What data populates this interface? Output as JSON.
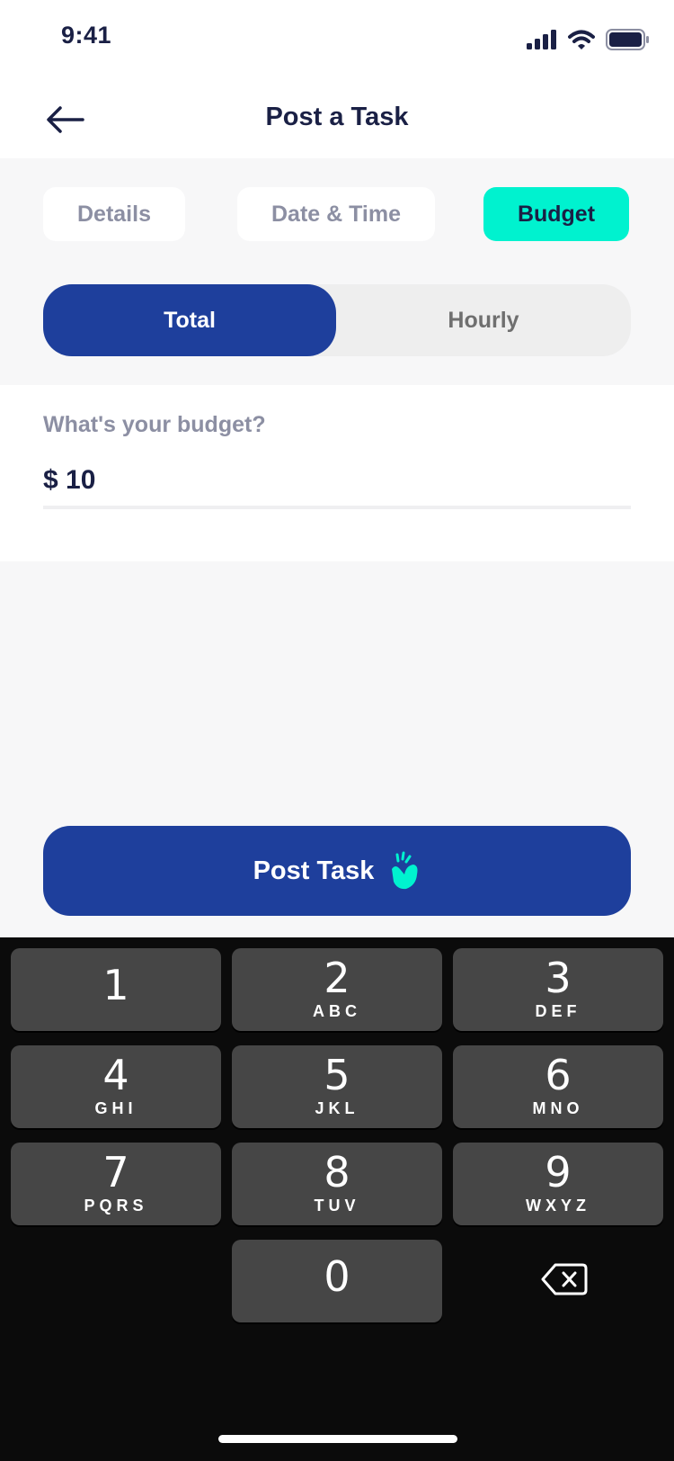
{
  "status_bar": {
    "time": "9:41"
  },
  "nav": {
    "title": "Post a Task",
    "back_icon": "arrow-left-icon"
  },
  "steps": [
    {
      "label": "Details",
      "active": false
    },
    {
      "label": "Date & Time",
      "active": false
    },
    {
      "label": "Budget",
      "active": true
    }
  ],
  "budget_type": {
    "options": [
      "Total",
      "Hourly"
    ],
    "selected": "Total"
  },
  "budget": {
    "label": "What's your budget?",
    "value": "$ 10"
  },
  "post_button": {
    "label": "Post Task",
    "icon": "snap-hand-icon"
  },
  "keypad": {
    "keys": [
      {
        "digit": "1",
        "letters": ""
      },
      {
        "digit": "2",
        "letters": "ABC"
      },
      {
        "digit": "3",
        "letters": "DEF"
      },
      {
        "digit": "4",
        "letters": "GHI"
      },
      {
        "digit": "5",
        "letters": "JKL"
      },
      {
        "digit": "6",
        "letters": "MNO"
      },
      {
        "digit": "7",
        "letters": "PQRS"
      },
      {
        "digit": "8",
        "letters": "TUV"
      },
      {
        "digit": "9",
        "letters": "WXYZ"
      },
      {
        "digit": "0",
        "letters": ""
      }
    ],
    "delete_icon": "backspace-icon"
  },
  "colors": {
    "primary": "#1e3f9c",
    "accent": "#00f2cf",
    "text_dark": "#1a2045",
    "text_muted": "#8c8fa3",
    "keyboard_bg": "#0b0b0b",
    "key_bg": "#464646"
  }
}
